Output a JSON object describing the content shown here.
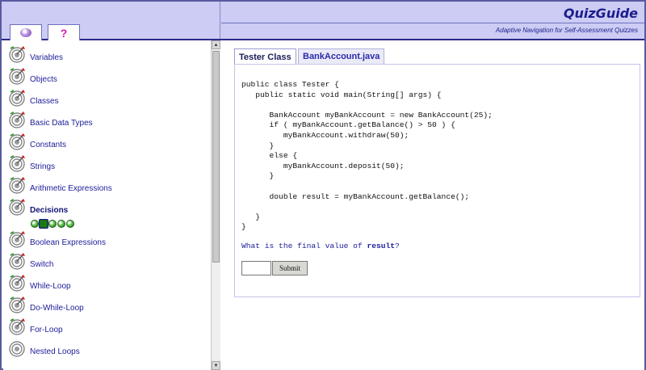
{
  "header": {
    "title": "QuizGuide",
    "subtitle": "Adaptive Navigation for Self-Assessment Quizzes",
    "tabs": [
      {
        "icon": "quiz-ball-icon"
      },
      {
        "icon": "help-question-icon",
        "glyph": "?"
      }
    ]
  },
  "sidebar": {
    "topics": [
      {
        "label": "Variables",
        "icon": "target-arrow-icon"
      },
      {
        "label": "Objects",
        "icon": "target-arrow-icon"
      },
      {
        "label": "Classes",
        "icon": "target-arrow-icon"
      },
      {
        "label": "Basic Data Types",
        "icon": "target-arrow-icon"
      },
      {
        "label": "Constants",
        "icon": "target-arrow-icon"
      },
      {
        "label": "Strings",
        "icon": "target-arrow-icon"
      },
      {
        "label": "Arithmetic Expressions",
        "icon": "target-arrow-icon"
      },
      {
        "label": "Decisions",
        "icon": "target-arrow-icon",
        "active": true
      },
      {
        "label": "Boolean Expressions",
        "icon": "target-arrow-icon"
      },
      {
        "label": "Switch",
        "icon": "target-arrow-icon"
      },
      {
        "label": "While-Loop",
        "icon": "target-arrow-icon"
      },
      {
        "label": "Do-While-Loop",
        "icon": "target-arrow-icon"
      },
      {
        "label": "For-Loop",
        "icon": "target-arrow-icon"
      },
      {
        "label": "Nested Loops",
        "icon": "target-icon"
      }
    ],
    "quiz_count": 5,
    "selected_quiz": 1
  },
  "main": {
    "tabs": [
      {
        "label": "Tester Class",
        "active": true
      },
      {
        "label": "BankAccount.java",
        "active": false
      }
    ],
    "code": "public class Tester {\n   public static void main(String[] args) {\n\n      BankAccount myBankAccount = new BankAccount(25);\n      if ( myBankAccount.getBalance() > 50 ) {\n         myBankAccount.withdraw(50);\n      }\n      else {\n         myBankAccount.deposit(50);\n      }\n\n      double result = myBankAccount.getBalance();\n\n   }\n}",
    "question_prefix": "What is the final value of ",
    "question_var": "result",
    "question_suffix": "?",
    "answer_value": "",
    "submit_label": "Submit"
  },
  "colors": {
    "header_bg": "#ccccf4",
    "header_border": "#2b2b8a",
    "title": "#1c1c8c",
    "link": "#1c1c9a"
  }
}
